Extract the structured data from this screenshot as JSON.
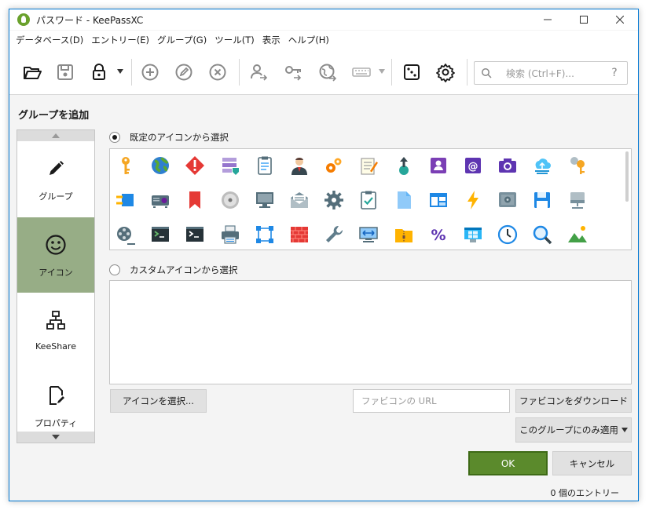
{
  "window": {
    "title": "パスワード - KeePassXC",
    "controls": [
      "minimize",
      "maximize",
      "close"
    ]
  },
  "menu": [
    "データベース(D)",
    "エントリー(E)",
    "グループ(G)",
    "ツール(T)",
    "表示",
    "ヘルプ(H)"
  ],
  "toolbar": {
    "buttons": [
      "open-database-icon",
      "save-database-icon",
      "lock-database-icon",
      "add-entry-icon",
      "edit-entry-icon",
      "delete-entry-icon",
      "copy-username-icon",
      "copy-password-icon",
      "open-url-icon",
      "autotype-icon",
      "password-generator-icon",
      "settings-icon"
    ],
    "search_placeholder": "検索 (Ctrl+F)...",
    "search_help": "?"
  },
  "page": {
    "heading": "グループを追加"
  },
  "sidebar": {
    "items": [
      {
        "label": "グループ",
        "icon": "pencil-icon",
        "active": false
      },
      {
        "label": "アイコン",
        "icon": "smiley-icon",
        "active": true
      },
      {
        "label": "KeeShare",
        "icon": "network-icon",
        "active": false
      },
      {
        "label": "プロパティ",
        "icon": "document-edit-icon",
        "active": false
      }
    ]
  },
  "icon_panel": {
    "default_option": "既定のアイコンから選択",
    "custom_option": "カスタムアイコンから選択",
    "selected_option": "default",
    "icons": [
      "key-icon",
      "globe-icon",
      "warning-icon",
      "server-icon",
      "clipboard-icon",
      "user-icon",
      "gears-icon",
      "notepad-icon",
      "globe-upload-icon",
      "identity-card-icon",
      "email-icon",
      "camera-icon",
      "cloud-icon",
      "keys-icon",
      "plug-icon",
      "projector-icon",
      "bookmark-icon",
      "disk-icon",
      "monitor-icon",
      "mail-icon",
      "gear-icon",
      "checklist-icon",
      "document-icon",
      "layout-icon",
      "lightning-icon",
      "safe-icon",
      "floppy-icon",
      "network-drive-icon",
      "film-icon",
      "terminal-icon",
      "console-icon",
      "printer-icon",
      "network-icon",
      "firewall-icon",
      "wrench-icon",
      "remote-desktop-icon",
      "folder-zip-icon",
      "percent-icon",
      "windows-icon",
      "clock-icon",
      "magnifier-icon",
      "landscape-icon"
    ]
  },
  "buttons": {
    "select_icon": "アイコンを選択...",
    "favicon_url_placeholder": "ファビコンの URL",
    "download_favicon": "ファビコンをダウンロード",
    "apply_scope": "このグループにのみ適用",
    "ok": "OK",
    "cancel": "キャンセル"
  },
  "status": "0 個のエントリー",
  "colors": {
    "accent_green": "#5b8a2c",
    "sidebar_active": "#97ad86",
    "window_border": "#0078d4"
  }
}
